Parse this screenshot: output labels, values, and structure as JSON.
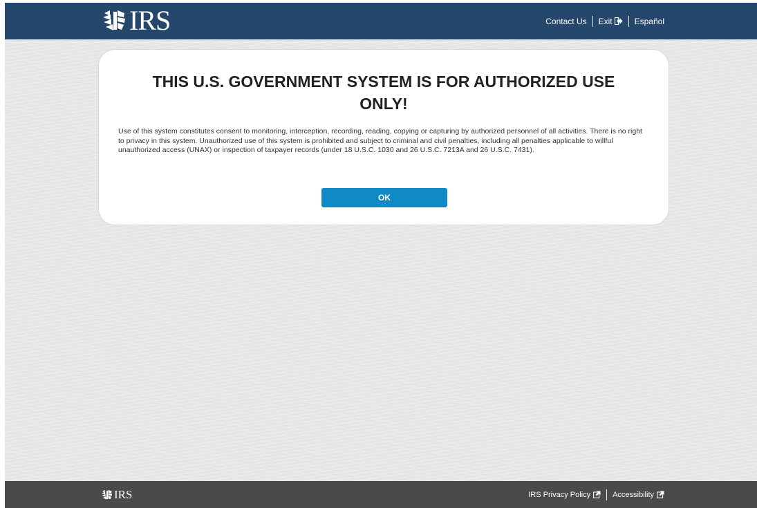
{
  "header": {
    "logo_text": "IRS",
    "links": {
      "contact": "Contact Us",
      "exit": "Exit",
      "espanol": "Español"
    }
  },
  "notice": {
    "title": "THIS U.S. GOVERNMENT SYSTEM IS FOR AUTHORIZED USE ONLY!",
    "body": "Use of this system constitutes consent to monitoring, interception, recording, reading, copying or capturing by authorized personnel of all activities. There is no right to privacy in this system. Unauthorized use of this system is prohibited and subject to criminal and civil penalties, including all penalties applicable to willful unauthorized access (UNAX) or inspection of taxpayer records (under 18 U.S.C. 1030 and 26 U.S.C. 7213A and 26 U.S.C. 7431).",
    "ok_label": "OK"
  },
  "footer": {
    "logo_text": "IRS",
    "links": {
      "privacy": "IRS Privacy Policy",
      "accessibility": "Accessibility"
    }
  },
  "colors": {
    "header_bg": "#24476b",
    "footer_bg": "#4a4a4a",
    "button_bg": "#0f8ac7",
    "page_bg": "#e6e6e6"
  },
  "icons": {
    "logo": "irs-eagle-icon",
    "exit": "exit-icon",
    "external": "external-link-icon"
  }
}
